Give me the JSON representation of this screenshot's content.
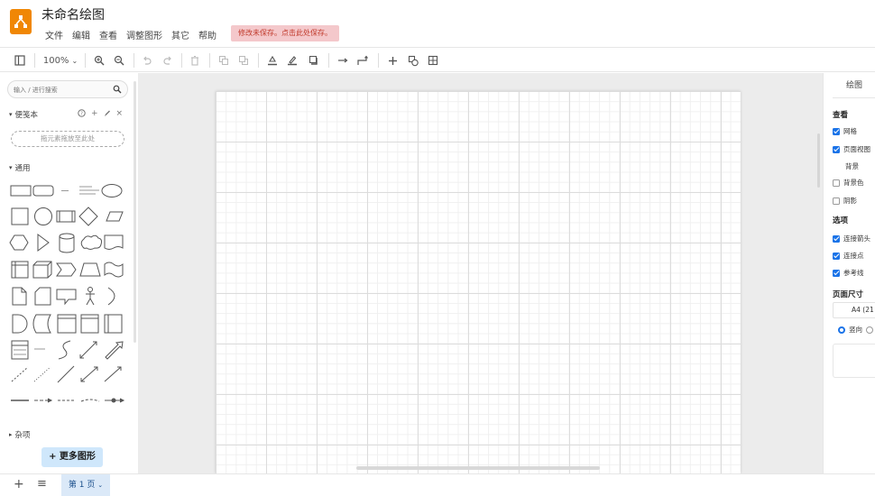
{
  "app": {
    "title": "未命名绘图",
    "brand_color": "#f08705",
    "logo_icon": "drawio-logo-icon"
  },
  "menu": [
    "文件",
    "编辑",
    "查看",
    "调整图形",
    "其它",
    "帮助"
  ],
  "alert": "修改未保存。点击此处保存。",
  "toolbar": {
    "zoom": "100%",
    "icons": [
      "format-panel-icon",
      "zoom-in-icon",
      "zoom-out-icon",
      "undo-icon",
      "redo-icon",
      "delete-icon",
      "to-front-icon",
      "to-back-icon",
      "fill-color-icon",
      "line-color-icon",
      "shadow-icon",
      "connection-icon",
      "waypoints-icon",
      "insert-icon",
      "add-shape-icon",
      "table-icon"
    ]
  },
  "sidebar": {
    "search_placeholder": "输入 / 进行搜索",
    "scratchpad": {
      "title": "便笺本",
      "dropzone": "拖元素拖放至此处"
    },
    "general": {
      "title": "通用"
    },
    "misc": {
      "title": "杂项"
    },
    "more_shapes": "+ 更多图形"
  },
  "format_panel": {
    "tab": "绘图",
    "view_section": "查看",
    "grid": "网格",
    "page_view": "页面视图",
    "background": "背景",
    "background_color": "背景色",
    "shadow": "阴影",
    "options_section": "选项",
    "connection_arrows": "连接箭头",
    "connection_points": "连接点",
    "guides": "参考线",
    "paper_size_section": "页面尺寸",
    "paper_size": "A4 (21",
    "orientation": "竖向"
  },
  "pages": {
    "current": "第 1 页"
  },
  "colors": {
    "accent": "#1a73e8",
    "alert_bg": "#f4c8cb",
    "page_tab_bg": "#dbe9f8",
    "canvas_bg": "#ececec"
  }
}
